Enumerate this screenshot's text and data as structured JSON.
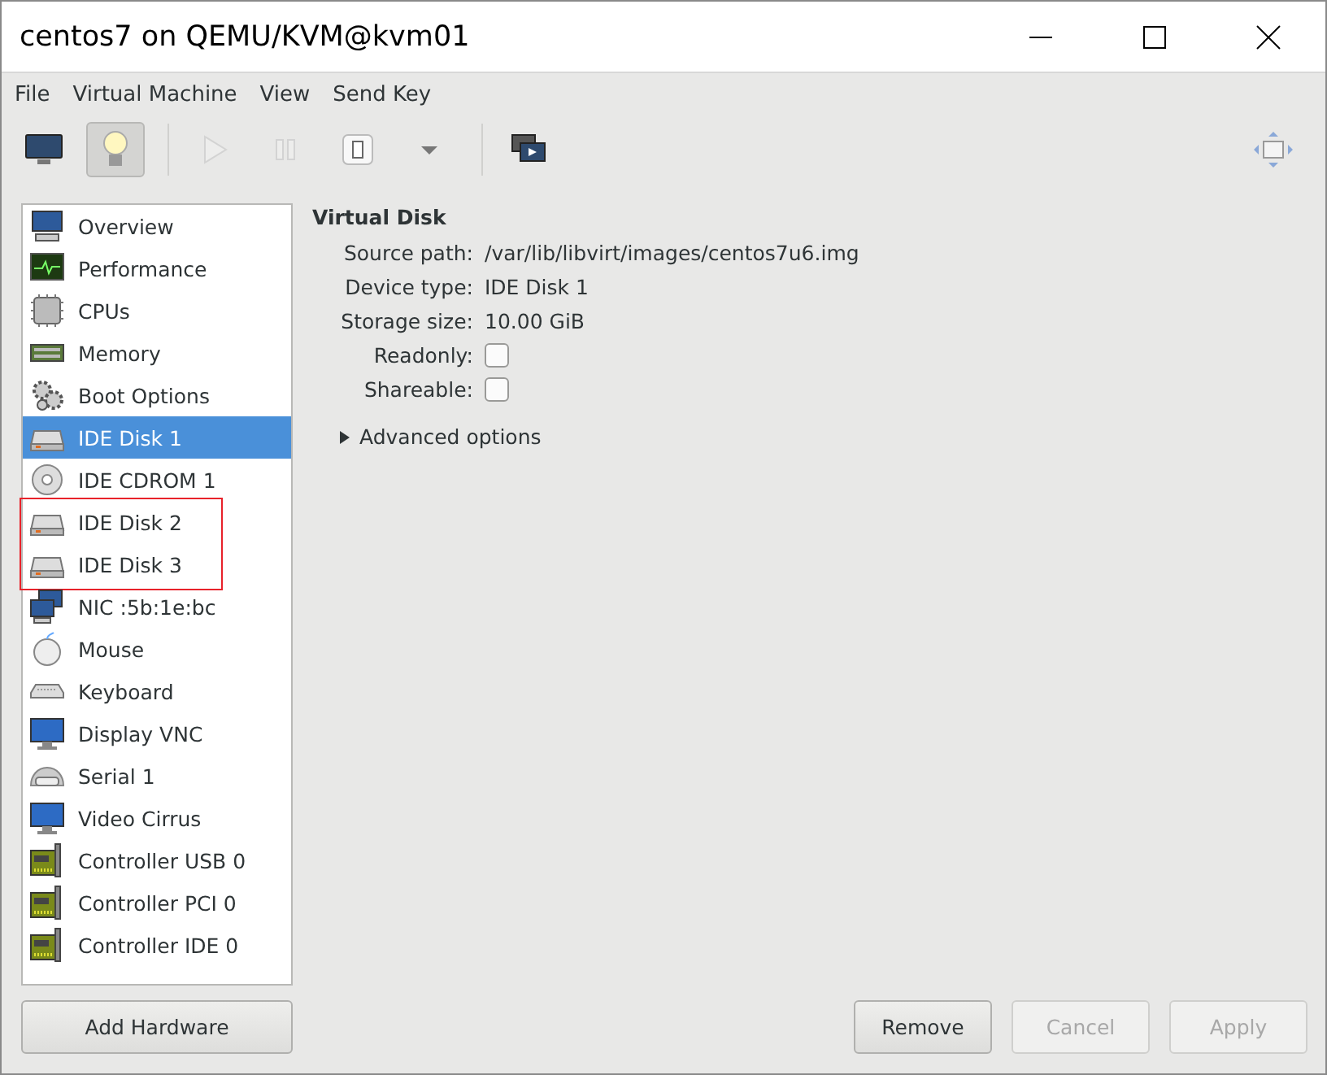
{
  "window": {
    "title": "centos7 on QEMU/KVM@kvm01"
  },
  "menu": [
    "File",
    "Virtual Machine",
    "View",
    "Send Key"
  ],
  "toolbar": [
    {
      "kind": "console",
      "selected": false,
      "disabled": false
    },
    {
      "kind": "details",
      "selected": true,
      "disabled": false
    },
    {
      "kind": "separator"
    },
    {
      "kind": "run",
      "selected": false,
      "disabled": true
    },
    {
      "kind": "pause",
      "selected": false,
      "disabled": true
    },
    {
      "kind": "shutdown",
      "selected": false,
      "disabled": false
    },
    {
      "kind": "dropdown",
      "selected": false,
      "disabled": false
    },
    {
      "kind": "separator"
    },
    {
      "kind": "snapshots",
      "selected": false,
      "disabled": false
    },
    {
      "kind": "spacer"
    },
    {
      "kind": "fullscreen",
      "selected": false,
      "disabled": false
    }
  ],
  "hardware": {
    "items": [
      {
        "kind": "overview",
        "label": "Overview",
        "selected": false,
        "highlighted": false
      },
      {
        "kind": "performance",
        "label": "Performance",
        "selected": false,
        "highlighted": false
      },
      {
        "kind": "cpu",
        "label": "CPUs",
        "selected": false,
        "highlighted": false
      },
      {
        "kind": "memory",
        "label": "Memory",
        "selected": false,
        "highlighted": false
      },
      {
        "kind": "boot",
        "label": "Boot Options",
        "selected": false,
        "highlighted": false
      },
      {
        "kind": "disk",
        "label": "IDE Disk 1",
        "selected": true,
        "highlighted": false
      },
      {
        "kind": "cdrom",
        "label": "IDE CDROM 1",
        "selected": false,
        "highlighted": false
      },
      {
        "kind": "disk",
        "label": "IDE Disk 2",
        "selected": false,
        "highlighted": true
      },
      {
        "kind": "disk",
        "label": "IDE Disk 3",
        "selected": false,
        "highlighted": true
      },
      {
        "kind": "nic",
        "label": "NIC :5b:1e:bc",
        "selected": false,
        "highlighted": false
      },
      {
        "kind": "mouse",
        "label": "Mouse",
        "selected": false,
        "highlighted": false
      },
      {
        "kind": "keyboard",
        "label": "Keyboard",
        "selected": false,
        "highlighted": false
      },
      {
        "kind": "display",
        "label": "Display VNC",
        "selected": false,
        "highlighted": false
      },
      {
        "kind": "serial",
        "label": "Serial 1",
        "selected": false,
        "highlighted": false
      },
      {
        "kind": "display",
        "label": "Video Cirrus",
        "selected": false,
        "highlighted": false
      },
      {
        "kind": "controller",
        "label": "Controller USB 0",
        "selected": false,
        "highlighted": false
      },
      {
        "kind": "controller",
        "label": "Controller PCI 0",
        "selected": false,
        "highlighted": false
      },
      {
        "kind": "controller",
        "label": "Controller IDE 0",
        "selected": false,
        "highlighted": false
      }
    ],
    "add_button": "Add Hardware"
  },
  "details": {
    "title": "Virtual Disk",
    "fields": [
      {
        "kind": "text",
        "label": "Source path:",
        "value": "/var/lib/libvirt/images/centos7u6.img"
      },
      {
        "kind": "text",
        "label": "Device type:",
        "value": "IDE Disk 1"
      },
      {
        "kind": "text",
        "label": "Storage size:",
        "value": "10.00 GiB"
      },
      {
        "kind": "checkbox",
        "label": "Readonly:",
        "checked": false
      },
      {
        "kind": "checkbox",
        "label": "Shareable:",
        "checked": false
      }
    ],
    "expander": {
      "label": "Advanced options",
      "expanded": false
    }
  },
  "buttons": [
    {
      "label": "Remove",
      "disabled": false
    },
    {
      "label": "Cancel",
      "disabled": true
    },
    {
      "label": "Apply",
      "disabled": true
    }
  ]
}
